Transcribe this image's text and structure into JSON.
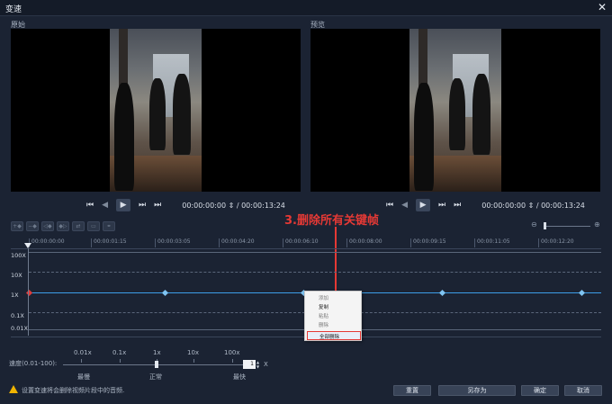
{
  "window": {
    "title": "变速",
    "close_glyph": "✕"
  },
  "panels": {
    "original_label": "原始",
    "preview_label": "预览"
  },
  "playback": {
    "left": {
      "start": "⏮",
      "prev": "◀",
      "play": "▶",
      "next": "⏭",
      "end": "⏭"
    },
    "timecode_left": "00:00:00:00 ⇕ / 00:00:13:24",
    "timecode_right": "00:00:00:00 ⇕ / 00:00:13:24"
  },
  "timeline": {
    "ticks": [
      "00:00:00:00",
      "00:00:01:15",
      "00:00:03:05",
      "00:00:04:20",
      "00:00:06:10",
      "00:00:08:00",
      "00:00:09:15",
      "00:00:11:05",
      "00:00:12:20"
    ],
    "y_labels": [
      "100X",
      "10X",
      "1X",
      "0.1X",
      "0.01X"
    ]
  },
  "annotation": {
    "text": "3.删除所有关键帧"
  },
  "context_menu": {
    "items": [
      "添加",
      "复制",
      "粘贴",
      "删除"
    ],
    "highlight": "全部删除"
  },
  "speed": {
    "presets": [
      "0.01x",
      "0.1x",
      "1x",
      "10x",
      "100x"
    ],
    "label": "速度(0.01-100):",
    "value": "1",
    "unit": "X",
    "slider_fraction": 0.5,
    "captions": {
      "slowest": "最慢",
      "normal": "正常",
      "fastest": "最快"
    }
  },
  "warning": {
    "text": "设置变速将会删除视频片段中的音频."
  },
  "buttons": {
    "reset": "重置",
    "save_as": "另存为",
    "ok": "确定",
    "cancel": "取消"
  },
  "colors": {
    "background": "#1b2333",
    "speed_line": "#3d9ee8",
    "annotation": "#e53935",
    "keyframe": "#7fc4f2"
  }
}
